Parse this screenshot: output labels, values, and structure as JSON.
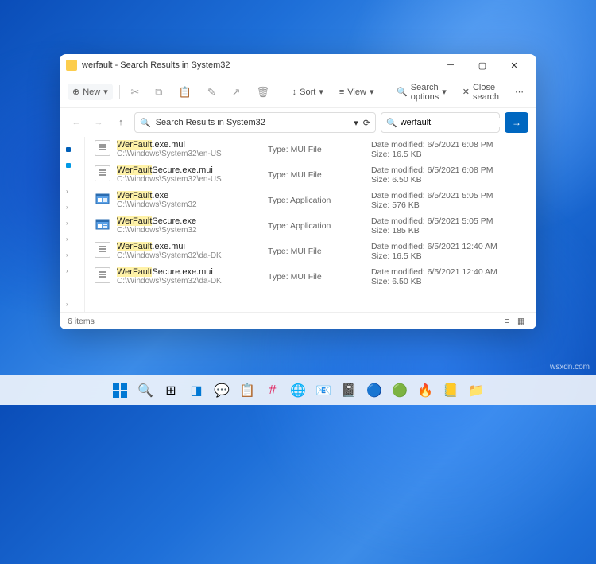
{
  "window": {
    "title": "werfault - Search Results in System32"
  },
  "toolbar": {
    "new": "New",
    "sort": "Sort",
    "view": "View",
    "search_options": "Search options",
    "close_search": "Close search"
  },
  "address": {
    "path": "Search Results in System32",
    "refresh_symbol": "⟳"
  },
  "search": {
    "value": "werfault",
    "clear_symbol": "×",
    "go_symbol": "→"
  },
  "results": [
    {
      "icon": "mui",
      "hl": "WerFault",
      "rest": ".exe.mui",
      "path": "C:\\Windows\\System32\\en-US",
      "type_label": "Type:",
      "type": "MUI File",
      "date_label": "Date modified:",
      "date": "6/5/2021 6:08 PM",
      "size_label": "Size:",
      "size": "16.5 KB"
    },
    {
      "icon": "mui",
      "hl": "WerFault",
      "rest": "Secure.exe.mui",
      "path": "C:\\Windows\\System32\\en-US",
      "type_label": "Type:",
      "type": "MUI File",
      "date_label": "Date modified:",
      "date": "6/5/2021 6:08 PM",
      "size_label": "Size:",
      "size": "6.50 KB"
    },
    {
      "icon": "exe",
      "hl": "WerFault",
      "rest": ".exe",
      "path": "C:\\Windows\\System32",
      "type_label": "Type:",
      "type": "Application",
      "date_label": "Date modified:",
      "date": "6/5/2021 5:05 PM",
      "size_label": "Size:",
      "size": "576 KB"
    },
    {
      "icon": "exe",
      "hl": "WerFault",
      "rest": "Secure.exe",
      "path": "C:\\Windows\\System32",
      "type_label": "Type:",
      "type": "Application",
      "date_label": "Date modified:",
      "date": "6/5/2021 5:05 PM",
      "size_label": "Size:",
      "size": "185 KB"
    },
    {
      "icon": "mui",
      "hl": "WerFault",
      "rest": ".exe.mui",
      "path": "C:\\Windows\\System32\\da-DK",
      "type_label": "Type:",
      "type": "MUI File",
      "date_label": "Date modified:",
      "date": "6/5/2021 12:40 AM",
      "size_label": "Size:",
      "size": "16.5 KB"
    },
    {
      "icon": "mui",
      "hl": "WerFault",
      "rest": "Secure.exe.mui",
      "path": "C:\\Windows\\System32\\da-DK",
      "type_label": "Type:",
      "type": "MUI File",
      "date_label": "Date modified:",
      "date": "6/5/2021 12:40 AM",
      "size_label": "Size:",
      "size": "6.50 KB"
    }
  ],
  "status": {
    "count": "6 items"
  },
  "watermark": "wsxdn.com"
}
